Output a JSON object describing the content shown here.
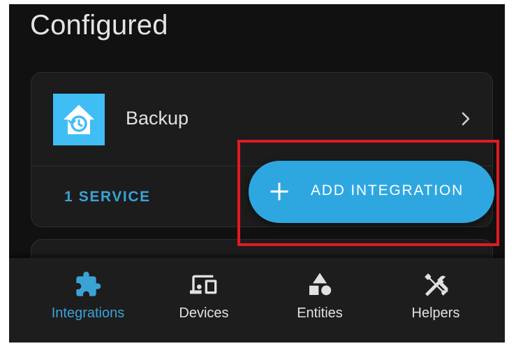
{
  "page": {
    "title": "Configured"
  },
  "card": {
    "title": "Backup",
    "service_link": "1 SERVICE",
    "logo_icon": "home-assistant-backup-icon"
  },
  "fab": {
    "label": "ADD INTEGRATION",
    "icon": "plus-icon"
  },
  "nav": {
    "items": [
      {
        "label": "Integrations",
        "icon": "puzzle-icon",
        "active": true
      },
      {
        "label": "Devices",
        "icon": "devices-icon",
        "active": false
      },
      {
        "label": "Entities",
        "icon": "shapes-icon",
        "active": false
      },
      {
        "label": "Helpers",
        "icon": "tools-icon",
        "active": false
      }
    ]
  },
  "colors": {
    "accent": "#2ea7e0",
    "logo_bg": "#41bdf5",
    "highlight": "#e01b22",
    "background": "#111111"
  }
}
